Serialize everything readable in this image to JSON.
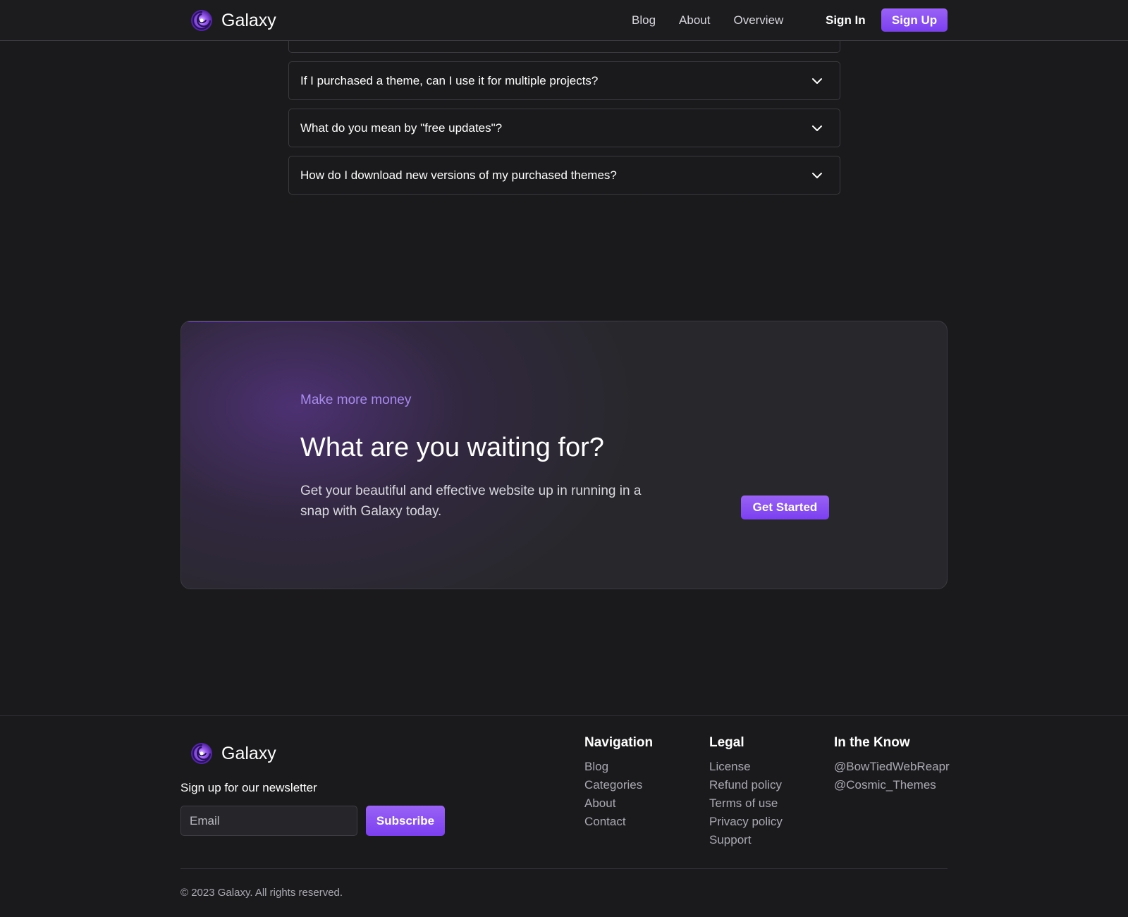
{
  "header": {
    "brand": "Galaxy",
    "nav": [
      "Blog",
      "About",
      "Overview"
    ],
    "sign_in": "Sign In",
    "sign_up": "Sign Up"
  },
  "faq": {
    "items": [
      "If I purchased a theme, can I use it for multiple projects?",
      "What do you mean by \"free updates\"?",
      "How do I download new versions of my purchased themes?"
    ]
  },
  "cta": {
    "eyebrow": "Make more money",
    "title": "What are you waiting for?",
    "text": "Get your beautiful and effective website up in running in a snap with Galaxy today.",
    "button": "Get Started"
  },
  "footer": {
    "brand": "Galaxy",
    "newsletter_label": "Sign up for our newsletter",
    "email_placeholder": "Email",
    "subscribe": "Subscribe",
    "columns": {
      "navigation": {
        "title": "Navigation",
        "links": [
          "Blog",
          "Categories",
          "About",
          "Contact"
        ]
      },
      "legal": {
        "title": "Legal",
        "links": [
          "License",
          "Refund policy",
          "Terms of use",
          "Privacy policy",
          "Support"
        ]
      },
      "know": {
        "title": "In the Know",
        "links": [
          "@BowTiedWebReapr",
          "@Cosmic_Themes"
        ]
      }
    },
    "copyright": "© 2023 Galaxy. All rights reserved."
  },
  "colors": {
    "background": "#1a1a1d",
    "accent": "#8b50f2",
    "eyebrow": "#a98bf0",
    "muted_text": "#a9a9b1"
  },
  "icons": [
    "galaxy-logo-icon",
    "chevron-down-icon"
  ]
}
